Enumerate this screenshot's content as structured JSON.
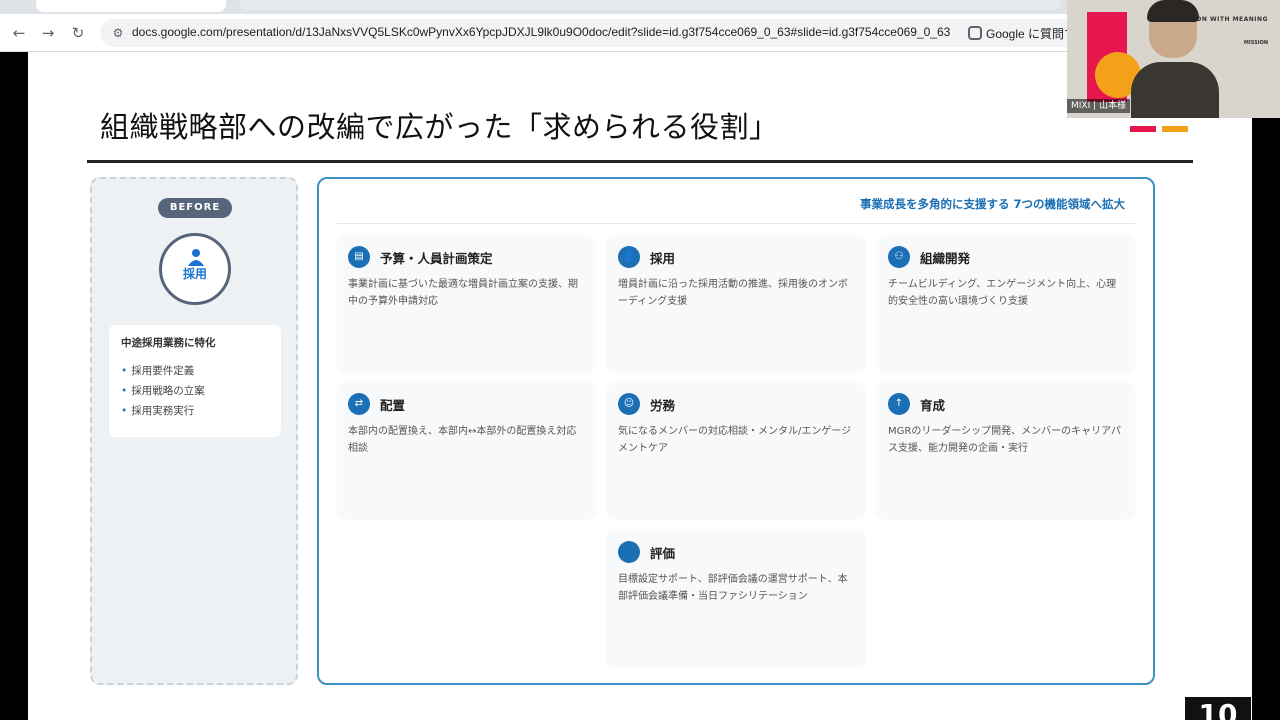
{
  "browser": {
    "back_icon": "←",
    "forward_icon": "→",
    "reload_icon": "↻",
    "site_info_icon": "⚙",
    "url": "docs.google.com/presentation/d/13JaNxsVVQ5LSKc0wPynvXx6YpcpJDXJL9lk0u9O0doc/edit?slide=id.g3f754cce069_0_63#slide=id.g3f754cce069_0_63",
    "lens_label": "Google に質問す"
  },
  "slide": {
    "title": "組織戦略部への改編で広がった「求められる役割」",
    "before": {
      "badge": "BEFORE",
      "circle_label": "採用",
      "card_title": "中途採用業務に特化",
      "items": [
        "採用要件定義",
        "採用戦略の立案",
        "採用実務実行"
      ]
    },
    "after": {
      "heading": "事業成長を多角的に支援する 7つの機能領域へ拡大",
      "cards": [
        {
          "icon": "▤",
          "title": "予算・人員計画策定",
          "desc": "事業計画に基づいた最適な増員計画立案の支援、期中の予算外申請対応"
        },
        {
          "icon": "👤",
          "title": "採用",
          "desc": "増員計画に沿った採用活動の推進、採用後のオンボーディング支援"
        },
        {
          "icon": "⚇",
          "title": "組織開発",
          "desc": "チームビルディング、エンゲージメント向上、心理的安全性の高い環境づくり支援"
        },
        {
          "icon": "⇄",
          "title": "配置",
          "desc": "本部内の配置換え、本部内↔本部外の配置換え対応相談"
        },
        {
          "icon": "☺",
          "title": "労務",
          "desc": "気になるメンバーの対応相談・メンタル/エンゲージメントケア"
        },
        {
          "icon": "↑",
          "title": "育成",
          "desc": "MGRのリーダーシップ開発、メンバーのキャリアパス支援、能力開発の企画・実行"
        },
        {
          "icon": "",
          "title": "評価",
          "desc": "目標設定サポート、部評価会議の運営サポート、本部評価会議準備・当日ファシリテーション"
        }
      ]
    },
    "page_number": "10"
  },
  "webcam": {
    "tagline": "CONNECTION WITH MEANING",
    "mission": "MISSION",
    "name_label": "MIXI | 山本様"
  },
  "colors": {
    "accent_blue": "#1a6fb5",
    "brand_red": "#e5174d",
    "brand_yellow": "#f4a11a"
  }
}
